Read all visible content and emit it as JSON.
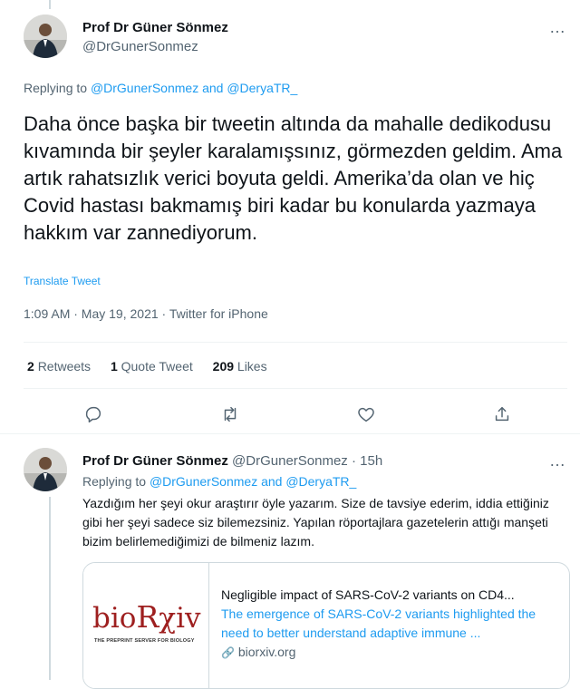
{
  "main_tweet": {
    "author_name": "Prof Dr Güner Sönmez",
    "author_handle": "@DrGunerSonmez",
    "more_icon": "…",
    "replying_prefix": "Replying to ",
    "replying_mentions": "@DrGunerSonmez and @DeryaTR_",
    "text": "Daha önce başka bir tweetin altında da mahalle dedikodusu kıvamında bir şeyler karalamışsınız, görmezden geldim. Ama artık rahatsızlık verici boyuta geldi. Amerika’da olan ve hiç Covid hastası bakmamış biri kadar bu konularda yazmaya hakkım var zannediyorum.",
    "translate_label": "Translate Tweet",
    "timestamp": "1:09 AM · May 19, 2021 · Twitter for iPhone",
    "stats": {
      "retweets_count": "2",
      "retweets_label": "Retweets",
      "quotes_count": "1",
      "quotes_label": "Quote Tweet",
      "likes_count": "209",
      "likes_label": "Likes"
    },
    "actions": [
      "reply-icon",
      "retweet-icon",
      "like-icon",
      "share-icon"
    ]
  },
  "reply_tweet": {
    "author_name": "Prof Dr Güner Sönmez",
    "author_handle": "@DrGunerSonmez",
    "time": "· 15h",
    "more_icon": "…",
    "replying_prefix": "Replying to ",
    "replying_mentions": "@DrGunerSonmez and @DeryaTR_",
    "text": "Yazdığım her şeyi okur araştırır öyle yazarım. Size de tavsiye ederim, iddia ettiğiniz gibi her şeyi sadece siz bilemezsiniz. Yapılan röportajlara gazetelerin attığı manşeti bizim belirlemediğimizi de bilmeniz lazım.",
    "card": {
      "logo_prefix": "bio",
      "logo_mid": "R",
      "logo_suffix": "χiv",
      "logo_tagline": "THE PREPRINT SERVER FOR BIOLOGY",
      "title": "Negligible impact of SARS-CoV-2 variants on CD4...",
      "description": "The emergence of SARS-CoV-2 variants highlighted the need to better understand adaptive immune ...",
      "domain": "biorxiv.org",
      "link_icon": "🔗"
    }
  },
  "colors": {
    "accent": "#1d9bf0",
    "secondary_text": "#536471",
    "divider": "#eff3f4",
    "biorxiv_red": "#9e1f1f"
  }
}
